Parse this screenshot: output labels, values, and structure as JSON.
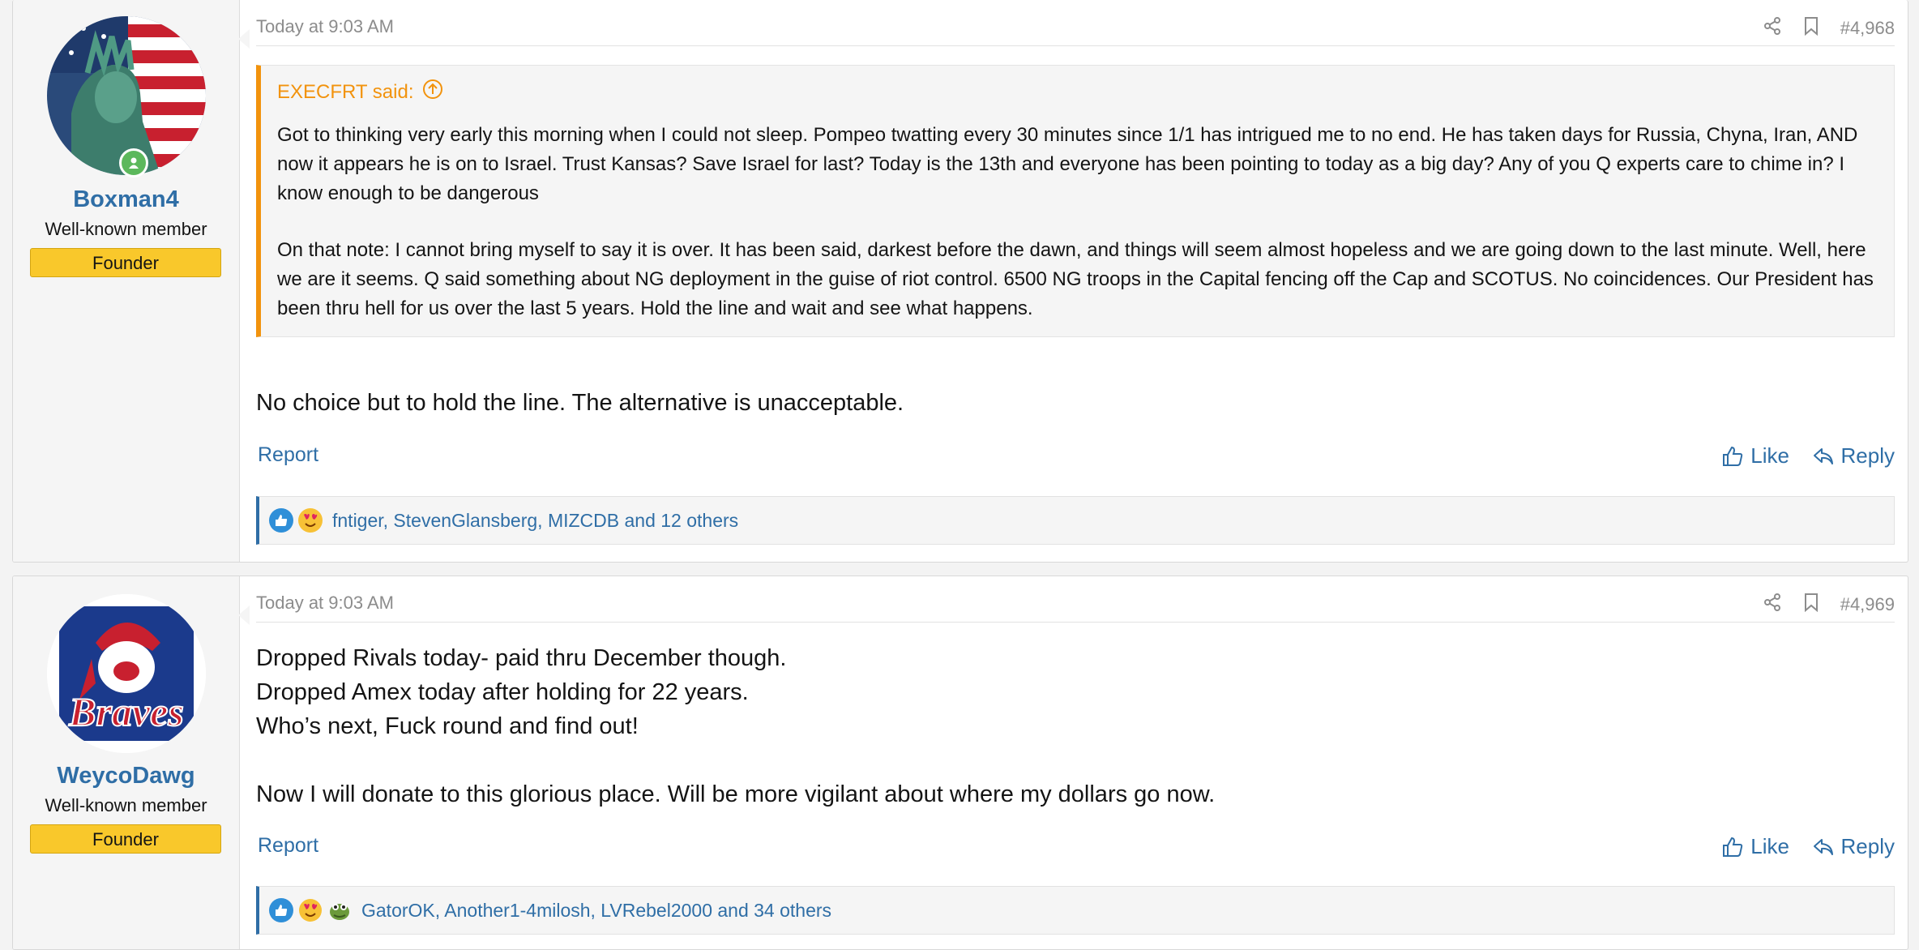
{
  "posts": [
    {
      "user": {
        "name": "Boxman4",
        "title": "Well-known member",
        "banner": "Founder"
      },
      "date": "Today at 9:03 AM",
      "number": "#4,968",
      "quote": {
        "author": "EXECFRT said:",
        "paragraphs": [
          "Got to thinking very early this morning when I could not sleep. Pompeo twatting every 30 minutes since 1/1 has intrigued me to no end. He has taken days for Russia, Chyna, Iran, AND now it appears he is on to Israel. Trust Kansas? Save Israel for last? Today is the 13th and everyone has been pointing to today as a big day? Any of you Q experts care to chime in? I know enough to be dangerous",
          "On that note: I cannot bring myself to say it is over. It has been said, darkest before the dawn, and things will seem almost hopeless and we are going down to the last minute. Well, here we are it seems. Q said something about NG deployment in the guise of riot control. 6500 NG troops in the Capital fencing off the Cap and SCOTUS. No coincidences. Our President has been thru hell for us over the last 5 years. Hold the line and wait and see what happens."
        ]
      },
      "body": "No choice but to hold the line. The alternative is unacceptable.",
      "report": "Report",
      "like": "Like",
      "reply": "Reply",
      "reactions": "fntiger, StevenGlansberg, MIZCDB and 12 others"
    },
    {
      "user": {
        "name": "WeycoDawg",
        "title": "Well-known member",
        "banner": "Founder"
      },
      "date": "Today at 9:03 AM",
      "number": "#4,969",
      "body_lines": [
        "Dropped Rivals today- paid thru December though.",
        "Dropped Amex today after holding for 22 years.",
        "Who’s next, Fuck round and find out!",
        "Now I will donate to this glorious place. Will be more vigilant about where my dollars go now."
      ],
      "report": "Report",
      "like": "Like",
      "reply": "Reply",
      "reactions": "GatorOK, Another1-4milosh, LVRebel2000 and 34 others",
      "avatar_text": "Braves"
    }
  ],
  "colors": {
    "link": "#2f6ea6",
    "quote_accent": "#f2930d",
    "banner": "#f9c82b",
    "online": "#5cb85c"
  }
}
